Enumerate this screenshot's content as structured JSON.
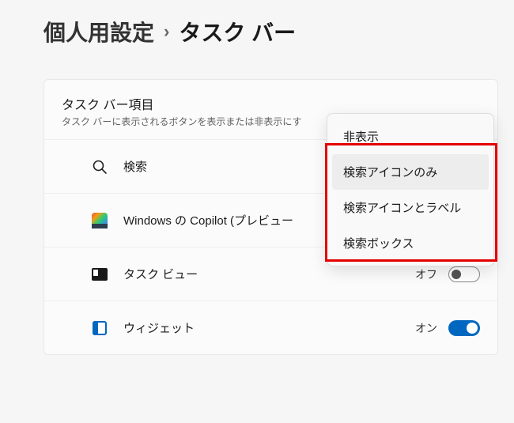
{
  "breadcrumb": {
    "parent": "個人用設定",
    "current": "タスク バー"
  },
  "section": {
    "title": "タスク バー項目",
    "subtitle": "タスク バーに表示されるボタンを表示または非表示にす"
  },
  "rows": {
    "search": {
      "label": "検索"
    },
    "copilot": {
      "label": "Windows の Copilot (プレビュー"
    },
    "taskview": {
      "label": "タスク ビュー",
      "state": "オフ"
    },
    "widgets": {
      "label": "ウィジェット",
      "state": "オン"
    }
  },
  "dropdown": {
    "options": {
      "hide": "非表示",
      "icon_only": "検索アイコンのみ",
      "icon_label": "検索アイコンとラベル",
      "box": "検索ボックス"
    }
  }
}
